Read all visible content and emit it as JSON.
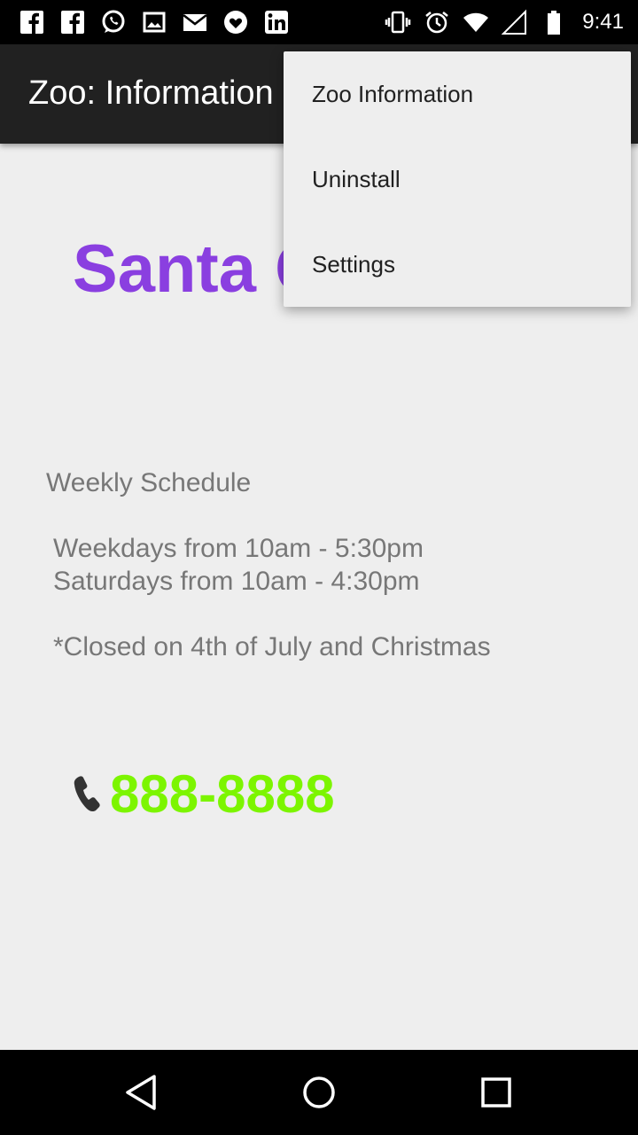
{
  "status_bar": {
    "time": "9:41",
    "left_icons": [
      "facebook-icon",
      "facebook-icon",
      "whatsapp-icon",
      "image-icon",
      "mail-icon",
      "heart-icon",
      "linkedin-icon"
    ],
    "right_icons": [
      "vibrate-icon",
      "alarm-icon",
      "wifi-icon",
      "signal-icon",
      "battery-icon"
    ]
  },
  "app_bar": {
    "title": "Zoo: Information"
  },
  "main": {
    "zoo_name": "Santa Cruz Zoo",
    "schedule_heading": "Weekly Schedule",
    "schedule_lines": [
      "Weekdays from 10am - 5:30pm",
      "Saturdays from 10am - 4:30pm"
    ],
    "closed_note": "*Closed on 4th of July and Christmas",
    "phone": "888-8888"
  },
  "overflow_menu": {
    "items": [
      "Zoo Information",
      "Uninstall",
      "Settings"
    ]
  },
  "colors": {
    "zoo_name": "#8a3fe0",
    "phone": "#7cf500",
    "app_bar": "#212121",
    "background": "#eeeeee"
  },
  "nav_bar": {
    "buttons": [
      "back-icon",
      "home-icon",
      "recent-apps-icon"
    ]
  }
}
